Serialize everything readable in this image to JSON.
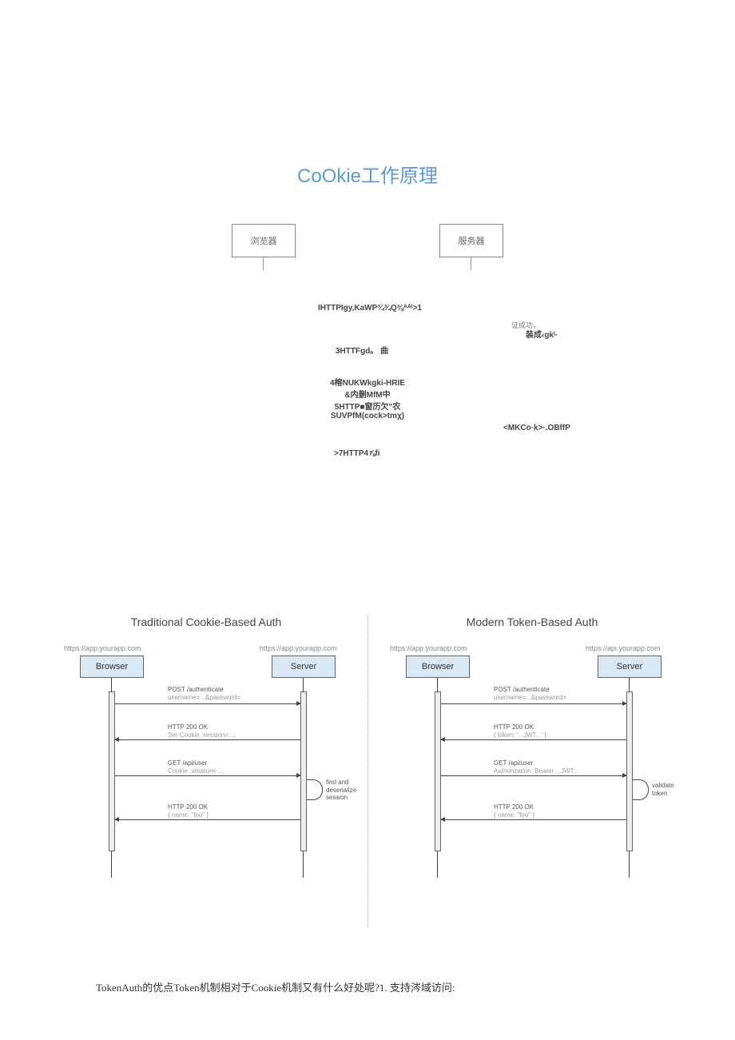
{
  "title": "CoOkie工作原理",
  "top_diagram": {
    "browser_box": "浏览器",
    "server_box": "服务器",
    "notes": {
      "n1": "IHTTPIgy,KaWP¾¾Q⅜ᴬᴬᴵ>1",
      "n2": "3HTTFgd。 曲",
      "n3": "4榕NUKWkgki-HRIE\n&内删MfM中",
      "n4": "5HTTP■窗历欠\"农\nSUVPfM(cock>tmχ)",
      "n5": ">7HTTP4⅞fi",
      "side1a": "证成功，",
      "side1b": "装成‹gkᴵ·",
      "side2": "<MKCo·k>·.OBffP"
    }
  },
  "lower": {
    "left": {
      "title": "Traditional Cookie-Based Auth",
      "url_left": "https://app.yourapp.com",
      "url_right": "https://app.yourapp.com",
      "browser": "Browser",
      "server": "Server",
      "m1a": "POST /authenticate",
      "m1b": "username=...&password=",
      "m2a": "HTTP 200 OK",
      "m2b": "Set-Cookie: session=...;",
      "m3a": "GET /api/user",
      "m3b": "Cookie: session=...;",
      "loop": "find and\ndeserialize\nsession",
      "m4a": "HTTP 200 OK",
      "m4b": "{ name: \"foo\" }"
    },
    "right": {
      "title": "Modern Token-Based Auth",
      "url_left": "https://app.yourapp.com",
      "url_right": "https://api.yourapp.com",
      "browser": "Browser",
      "server": "Server",
      "m1a": "POST /authenticate",
      "m1b": "username=...&password=",
      "m2a": "HTTP 200 OK",
      "m2b": "{ token: '...JWT...' }",
      "m3a": "GET /api/user",
      "m3b": "Authorization: Bearer ...JWT...",
      "loop": "validate\ntoken",
      "m4a": "HTTP 200 OK",
      "m4b": "{ name: \"foo\" }"
    }
  },
  "footer": "TokenAuth的优点Token机制相对于Cookie机制又有什么好处呢?1. 支持涔域访问:",
  "chart_data": {
    "type": "diagram",
    "diagrams": [
      {
        "name": "Cookie工作原理",
        "kind": "sequence",
        "participants": [
          "浏览器",
          "服务器"
        ],
        "steps_text": [
          "IHTTPIgy,KaWP¾¾Q⅜ᴬᴬᴵ>1",
          "证成功，装成‹gkᴵ·",
          "3HTTFgd。 曲",
          "4榕NUKWkgki-HRIE &内删MfM中",
          "5HTTP■窗历欠\"农 SUVPfM(cock>tmχ)",
          "<MKCo·k>·.OBffP",
          ">7HTTP4⅞fi"
        ]
      },
      {
        "name": "Traditional Cookie-Based Auth",
        "kind": "sequence",
        "participants": [
          "Browser",
          "Server"
        ],
        "messages": [
          {
            "from": "Browser",
            "to": "Server",
            "label": "POST /authenticate username=...&password="
          },
          {
            "from": "Server",
            "to": "Browser",
            "label": "HTTP 200 OK Set-Cookie: session=...;"
          },
          {
            "from": "Browser",
            "to": "Server",
            "label": "GET /api/user Cookie: session=...;"
          },
          {
            "from": "Server",
            "to": "Server",
            "label": "find and deserialize session"
          },
          {
            "from": "Server",
            "to": "Browser",
            "label": "HTTP 200 OK { name: \"foo\" }"
          }
        ]
      },
      {
        "name": "Modern Token-Based Auth",
        "kind": "sequence",
        "participants": [
          "Browser",
          "Server"
        ],
        "messages": [
          {
            "from": "Browser",
            "to": "Server",
            "label": "POST /authenticate username=...&password="
          },
          {
            "from": "Server",
            "to": "Browser",
            "label": "HTTP 200 OK { token: '...JWT...' }"
          },
          {
            "from": "Browser",
            "to": "Server",
            "label": "GET /api/user Authorization: Bearer ...JWT..."
          },
          {
            "from": "Server",
            "to": "Server",
            "label": "validate token"
          },
          {
            "from": "Server",
            "to": "Browser",
            "label": "HTTP 200 OK { name: \"foo\" }"
          }
        ]
      }
    ]
  }
}
